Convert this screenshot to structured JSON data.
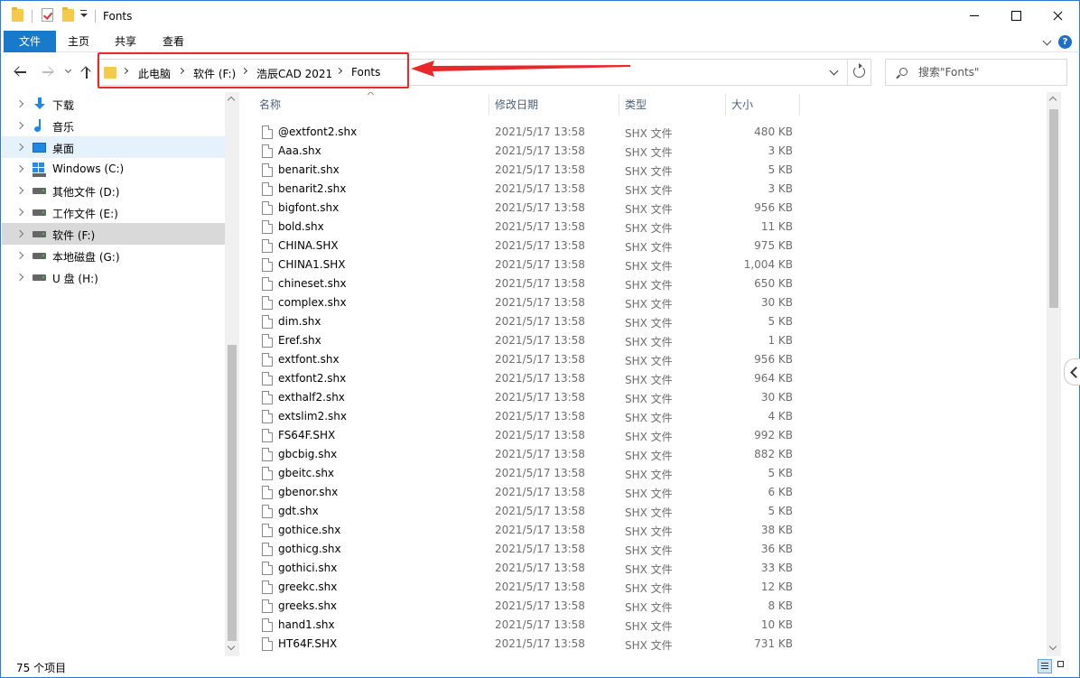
{
  "window": {
    "title": "Fonts",
    "controls": {
      "minimize": "",
      "maximize": "",
      "close": ""
    }
  },
  "ribbon": {
    "tabs": [
      "文件",
      "主页",
      "共享",
      "查看"
    ],
    "help": "?"
  },
  "address": {
    "crumbs": [
      "此电脑",
      "软件 (F:)",
      "浩辰CAD 2021",
      "Fonts"
    ]
  },
  "search": {
    "placeholder": "搜索\"Fonts\""
  },
  "nav": {
    "items": [
      {
        "label": "下载",
        "icon": "download-icon"
      },
      {
        "label": "音乐",
        "icon": "music-icon"
      },
      {
        "label": "桌面",
        "icon": "desktop-icon"
      },
      {
        "label": "Windows (C:)",
        "icon": "windows-drive-icon"
      },
      {
        "label": "其他文件 (D:)",
        "icon": "drive-icon"
      },
      {
        "label": "工作文件 (E:)",
        "icon": "drive-icon"
      },
      {
        "label": "软件 (F:)",
        "icon": "drive-icon"
      },
      {
        "label": "本地磁盘 (G:)",
        "icon": "drive-icon"
      },
      {
        "label": "U 盘 (H:)",
        "icon": "drive-icon"
      }
    ]
  },
  "columns": {
    "name": "名称",
    "date": "修改日期",
    "type": "类型",
    "size": "大小"
  },
  "files": [
    {
      "name": "@extfont2.shx",
      "date": "2021/5/17 13:58",
      "type": "SHX 文件",
      "size": "480 KB"
    },
    {
      "name": "Aaa.shx",
      "date": "2021/5/17 13:58",
      "type": "SHX 文件",
      "size": "3 KB"
    },
    {
      "name": "benarit.shx",
      "date": "2021/5/17 13:58",
      "type": "SHX 文件",
      "size": "5 KB"
    },
    {
      "name": "benarit2.shx",
      "date": "2021/5/17 13:58",
      "type": "SHX 文件",
      "size": "3 KB"
    },
    {
      "name": "bigfont.shx",
      "date": "2021/5/17 13:58",
      "type": "SHX 文件",
      "size": "956 KB"
    },
    {
      "name": "bold.shx",
      "date": "2021/5/17 13:58",
      "type": "SHX 文件",
      "size": "11 KB"
    },
    {
      "name": "CHINA.SHX",
      "date": "2021/5/17 13:58",
      "type": "SHX 文件",
      "size": "975 KB"
    },
    {
      "name": "CHINA1.SHX",
      "date": "2021/5/17 13:58",
      "type": "SHX 文件",
      "size": "1,004 KB"
    },
    {
      "name": "chineset.shx",
      "date": "2021/5/17 13:58",
      "type": "SHX 文件",
      "size": "650 KB"
    },
    {
      "name": "complex.shx",
      "date": "2021/5/17 13:58",
      "type": "SHX 文件",
      "size": "30 KB"
    },
    {
      "name": "dim.shx",
      "date": "2021/5/17 13:58",
      "type": "SHX 文件",
      "size": "5 KB"
    },
    {
      "name": "Eref.shx",
      "date": "2021/5/17 13:58",
      "type": "SHX 文件",
      "size": "1 KB"
    },
    {
      "name": "extfont.shx",
      "date": "2021/5/17 13:58",
      "type": "SHX 文件",
      "size": "956 KB"
    },
    {
      "name": "extfont2.shx",
      "date": "2021/5/17 13:58",
      "type": "SHX 文件",
      "size": "964 KB"
    },
    {
      "name": "exthalf2.shx",
      "date": "2021/5/17 13:58",
      "type": "SHX 文件",
      "size": "30 KB"
    },
    {
      "name": "extslim2.shx",
      "date": "2021/5/17 13:58",
      "type": "SHX 文件",
      "size": "4 KB"
    },
    {
      "name": "FS64F.SHX",
      "date": "2021/5/17 13:58",
      "type": "SHX 文件",
      "size": "992 KB"
    },
    {
      "name": "gbcbig.shx",
      "date": "2021/5/17 13:58",
      "type": "SHX 文件",
      "size": "882 KB"
    },
    {
      "name": "gbeitc.shx",
      "date": "2021/5/17 13:58",
      "type": "SHX 文件",
      "size": "5 KB"
    },
    {
      "name": "gbenor.shx",
      "date": "2021/5/17 13:58",
      "type": "SHX 文件",
      "size": "6 KB"
    },
    {
      "name": "gdt.shx",
      "date": "2021/5/17 13:58",
      "type": "SHX 文件",
      "size": "5 KB"
    },
    {
      "name": "gothice.shx",
      "date": "2021/5/17 13:58",
      "type": "SHX 文件",
      "size": "38 KB"
    },
    {
      "name": "gothicg.shx",
      "date": "2021/5/17 13:58",
      "type": "SHX 文件",
      "size": "36 KB"
    },
    {
      "name": "gothici.shx",
      "date": "2021/5/17 13:58",
      "type": "SHX 文件",
      "size": "33 KB"
    },
    {
      "name": "greekc.shx",
      "date": "2021/5/17 13:58",
      "type": "SHX 文件",
      "size": "12 KB"
    },
    {
      "name": "greeks.shx",
      "date": "2021/5/17 13:58",
      "type": "SHX 文件",
      "size": "8 KB"
    },
    {
      "name": "hand1.shx",
      "date": "2021/5/17 13:58",
      "type": "SHX 文件",
      "size": "10 KB"
    },
    {
      "name": "HT64F.SHX",
      "date": "2021/5/17 13:58",
      "type": "SHX 文件",
      "size": "731 KB"
    }
  ],
  "status": {
    "count": "75 个项目"
  },
  "colors": {
    "accent": "#1979ca",
    "annotation": "#e8282a",
    "nav_selected": "#e5f1fb"
  }
}
